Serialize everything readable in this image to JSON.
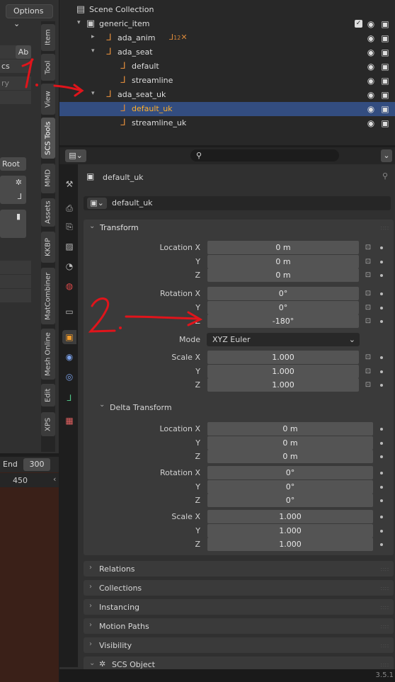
{
  "left_panel": {
    "options_label": "Options",
    "ab_label": "Ab",
    "cs_label": "cs",
    "ry_label": "ry",
    "root_label": "Root",
    "vertical_tabs": [
      "Item",
      "Tool",
      "View",
      "SCS Tools",
      "MMD",
      "Assets",
      "KKBP",
      "MatCombiner",
      "Mesh Online",
      "Edit",
      "XPS"
    ],
    "active_tab": "SCS Tools"
  },
  "timeline": {
    "end_label": "End",
    "end_value": "300",
    "frame_marker": "450"
  },
  "outliner": {
    "rows": [
      {
        "label": "Scene Collection"
      },
      {
        "label": "generic_item"
      },
      {
        "label": "ada_anim",
        "extra": "12"
      },
      {
        "label": "ada_seat"
      },
      {
        "label": "default"
      },
      {
        "label": "streamline"
      },
      {
        "label": "ada_seat_uk"
      },
      {
        "label": "default_uk"
      },
      {
        "label": "streamline_uk"
      }
    ],
    "selected": "default_uk"
  },
  "properties": {
    "object_name": "default_uk",
    "datablock_name": "default_uk",
    "transform": {
      "header": "Transform",
      "location_label": "Location X",
      "location": [
        "0 m",
        "0 m",
        "0 m"
      ],
      "rotation_label": "Rotation X",
      "rotation": [
        "0°",
        "0°",
        "-180°"
      ],
      "mode_label": "Mode",
      "mode_value": "XYZ Euler",
      "scale_label": "Scale X",
      "scale": [
        "1.000",
        "1.000",
        "1.000"
      ],
      "y_label": "Y",
      "z_label": "Z"
    },
    "delta": {
      "header": "Delta Transform",
      "location_label": "Location X",
      "location": [
        "0 m",
        "0 m",
        "0 m"
      ],
      "rotation_label": "Rotation X",
      "rotation": [
        "0°",
        "0°",
        "0°"
      ],
      "scale_label": "Scale X",
      "scale": [
        "1.000",
        "1.000",
        "1.000"
      ],
      "y_label": "Y",
      "z_label": "Z"
    },
    "collapsed_panels": [
      "Relations",
      "Collections",
      "Instancing",
      "Motion Paths",
      "Visibility",
      "SCS Object"
    ]
  },
  "annotations": {
    "one": "1.",
    "two": "2."
  },
  "version": "3.5.1",
  "colors": {
    "accent": "#ffaf29",
    "selection": "#334d80",
    "annotation": "#e0141b"
  }
}
